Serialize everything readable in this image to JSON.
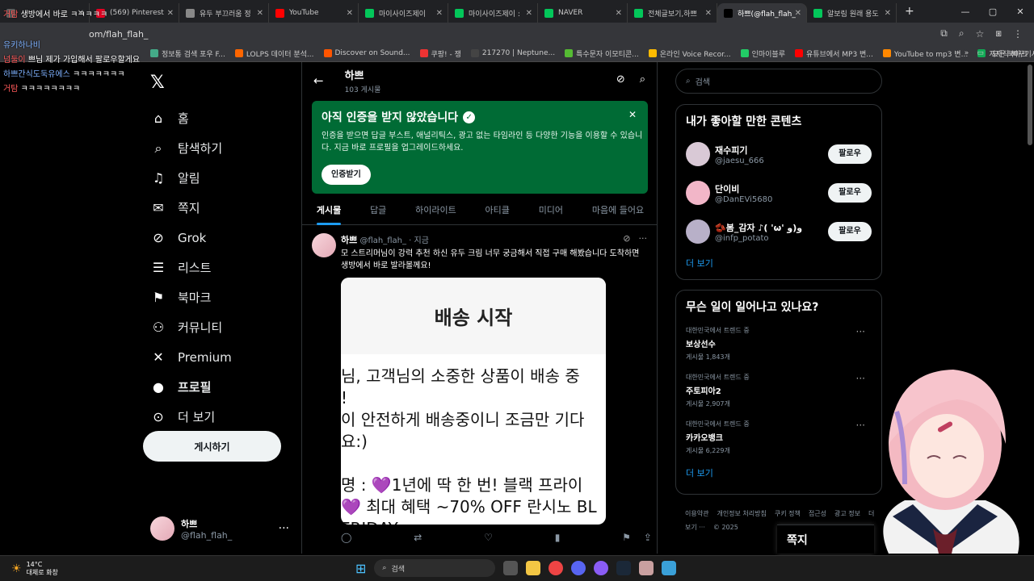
{
  "browser": {
    "tabs": [
      {
        "label": "",
        "icon": "blank-icon",
        "color": "#666"
      },
      {
        "label": "(569) Pinterest",
        "icon": "pinterest-icon",
        "color": "#e60023"
      },
      {
        "label": "유두 부끄러움 정",
        "icon": "globe-icon",
        "color": "#888"
      },
      {
        "label": "YouTube",
        "icon": "youtube-icon",
        "color": "#ff0000"
      },
      {
        "label": "마이사이즈제이",
        "icon": "naver-icon",
        "color": "#03c75a"
      },
      {
        "label": "마이사이즈제이 :",
        "icon": "shield-icon",
        "color": "#03c75a"
      },
      {
        "label": "NAVER",
        "icon": "naver-icon",
        "color": "#03c75a"
      },
      {
        "label": "전체글보기,하쁘",
        "icon": "naver-icon",
        "color": "#03c75a"
      },
      {
        "label": "하쁘(@flah_flah_",
        "icon": "x-icon",
        "color": "#000"
      },
      {
        "label": "알보림 원래 용도",
        "icon": "naver-icon",
        "color": "#03c75a"
      }
    ],
    "url": "om/flah_flah_",
    "bookmarks": [
      "정보통 검색 포우 F...",
      "LOLPS 데이터 분석...",
      "Discover on Sound...",
      "쿠팡! - 쟁",
      "217270 | Neptune...",
      "특수문자 이모티콘...",
      "온라인 Voice Recor...",
      "인마이블루",
      "유튜브에서 MP3 변...",
      "YouTube to mp3 변...",
      "지지직 빠꾸기사트..."
    ],
    "bookmarks_folder": "모든 북마크"
  },
  "chat": [
    {
      "name": "거탐",
      "text": "생방에서 바로 ㅋㅋㅋㅋㅋ"
    },
    {
      "name": "유키하나비",
      "text": ""
    },
    {
      "name": "넘둘이",
      "text": "쁘님 제가 가입해서 팔로우할게요"
    },
    {
      "name": "하쁘간식도둑유에스",
      "text": "ㅋㅋㅋㅋㅋㅋㅋ"
    },
    {
      "name": "거탐",
      "text": "ㅋㅋㅋㅋㅋㅋㅋㅋ"
    }
  ],
  "nav": {
    "items": [
      {
        "label": "홈",
        "icon": "home-icon",
        "glyph": "⌂"
      },
      {
        "label": "탐색하기",
        "icon": "search-icon",
        "glyph": "⌕"
      },
      {
        "label": "알림",
        "icon": "bell-icon",
        "glyph": "♫"
      },
      {
        "label": "쪽지",
        "icon": "mail-icon",
        "glyph": "✉"
      },
      {
        "label": "Grok",
        "icon": "grok-icon",
        "glyph": "⊘"
      },
      {
        "label": "리스트",
        "icon": "list-icon",
        "glyph": "☰"
      },
      {
        "label": "북마크",
        "icon": "bookmark-icon",
        "glyph": "⚑"
      },
      {
        "label": "커뮤니티",
        "icon": "community-icon",
        "glyph": "⚇"
      },
      {
        "label": "Premium",
        "icon": "x-premium-icon",
        "glyph": "✕"
      },
      {
        "label": "프로필",
        "icon": "profile-icon",
        "glyph": "●"
      },
      {
        "label": "더 보기",
        "icon": "more-circle-icon",
        "glyph": "⊙"
      }
    ],
    "post_button": "게시하기",
    "account": {
      "name": "하쁘",
      "handle": "@flah_flah_"
    }
  },
  "main": {
    "title": "하쁘",
    "post_count": "103 게시물",
    "verify": {
      "title": "아직 인증을 받지 않았습니다",
      "body": "인증을 받으면 답글 부스트, 애널리틱스, 광고 없는 타임라인 등 다양한 기능을 이용할 수 있습니다. 지금 바로 프로필을 업그레이드하세요.",
      "button": "인증받기"
    },
    "tabs": [
      "게시물",
      "답글",
      "하이라이트",
      "아티클",
      "미디어",
      "마음에 들어요"
    ],
    "tweet": {
      "name": "하쁘",
      "handle": "@flah_flah_",
      "time": "· 지금",
      "text": "모 스트리머님이 강력 추천 하신 유두 크림 너무 궁금해서 직접 구매 해봤습니다 도착하면 생방에서 바로 발라볼께요!",
      "image_title": "배송 시작",
      "image_lines": [
        "님, 고객님의 소중한 상품이 배송 중",
        "!",
        "이 안전하게 배송중이니 조금만 기다",
        "요:)",
        "",
        "명 : 💜1년에 딱 한 번! 블랙 프라이",
        "💜 최대 혜택 ~70% OFF  란시노 BL",
        "FRIDAY"
      ]
    }
  },
  "right": {
    "search_placeholder": "검색",
    "suggest_title": "내가 좋아할 만한 콘텐츠",
    "suggestions": [
      {
        "name": "재수피기",
        "handle": "@jaesu_666",
        "button": "팔로우",
        "color": "#d9c9d6"
      },
      {
        "name": "단이비",
        "handle": "@DanEVi5680",
        "button": "팔로우",
        "color": "#f2b6c8"
      },
      {
        "name": "🫘봄_감자 ♪( 'ω' و)و",
        "handle": "@infp_potato",
        "button": "팔로우",
        "color": "#b8b0c8"
      }
    ],
    "more": "더 보기",
    "trends_title": "무슨 일이 일어나고 있나요?",
    "trends": [
      {
        "context": "대한민국에서 트렌드 중",
        "name": "보상선수",
        "posts": "게시물 1,843개"
      },
      {
        "context": "대한민국에서 트렌드 중",
        "name": "주토피아2",
        "posts": "게시물 2,907개"
      },
      {
        "context": "대한민국에서 트렌드 중",
        "name": "카카오뱅크",
        "posts": "게시물 6,229개"
      }
    ],
    "footer": [
      "이용약관",
      "개인정보 처리방침",
      "쿠키 정책",
      "접근성",
      "광고 정보",
      "더 보기 ···",
      "© 2025"
    ],
    "dm": "쪽지"
  },
  "taskbar": {
    "temp": "14°C",
    "weather": "대체로 화창",
    "search": "검색"
  }
}
